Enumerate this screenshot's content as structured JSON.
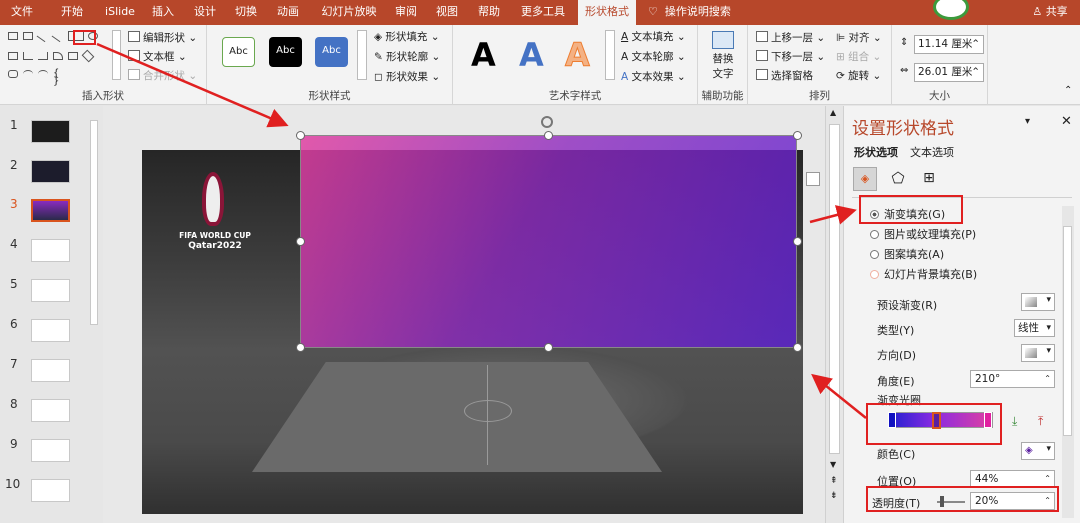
{
  "tabs": [
    "文件",
    "开始",
    "iSlide",
    "插入",
    "设计",
    "切换",
    "动画",
    "幻灯片放映",
    "审阅",
    "视图",
    "帮助",
    "更多工具",
    "形状格式"
  ],
  "active_tab": "形状格式",
  "search_label": "操作说明搜索",
  "share_label": "共享",
  "ribbon": {
    "insert_shapes": {
      "label": "插入形状",
      "edit_shape": "编辑形状",
      "text_box": "文本框",
      "merge_shapes": "合并形状"
    },
    "shape_styles": {
      "label": "形状样式",
      "sample": "Abc",
      "fill": "形状填充",
      "outline": "形状轮廓",
      "effects": "形状效果"
    },
    "wordart": {
      "label": "艺术字样式",
      "sample": "A",
      "text_fill": "文本填充",
      "text_outline": "文本轮廓",
      "text_effects": "文本效果"
    },
    "accessibility": {
      "label": "辅助功能",
      "alt_text_1": "替换",
      "alt_text_2": "文字"
    },
    "arrange": {
      "label": "排列",
      "bring_forward": "上移一层",
      "send_backward": "下移一层",
      "selection_pane": "选择窗格",
      "align": "对齐",
      "group": "组合",
      "rotate": "旋转"
    },
    "size": {
      "label": "大小",
      "height": "11.14 厘米",
      "width": "26.01 厘米"
    }
  },
  "slide_numbers": [
    "1",
    "2",
    "3",
    "4",
    "5",
    "6",
    "7",
    "8",
    "9",
    "10"
  ],
  "slide": {
    "logo_line1": "FIFA WORLD CUP",
    "logo_line2": "Qatar2022"
  },
  "pane": {
    "title": "设置形状格式",
    "tab_shape": "形状选项",
    "tab_text": "文本选项",
    "fill_options": [
      "渐变填充(G)",
      "图片或纹理填充(P)",
      "图案填充(A)",
      "幻灯片背景填充(B)"
    ],
    "preset_gradient": "预设渐变(R)",
    "type_label": "类型(Y)",
    "type_value": "线性",
    "direction_label": "方向(D)",
    "angle_label": "角度(E)",
    "angle_value": "210°",
    "stops_label": "渐变光圈",
    "color_label": "颜色(C)",
    "position_label": "位置(O)",
    "position_value": "44%",
    "transparency_label": "透明度(T)",
    "transparency_value": "20%"
  },
  "colors": {
    "accent": "#b7472a",
    "annotation": "#e02020",
    "gradient_start": "#e040a0",
    "gradient_end": "#5a20d0"
  }
}
